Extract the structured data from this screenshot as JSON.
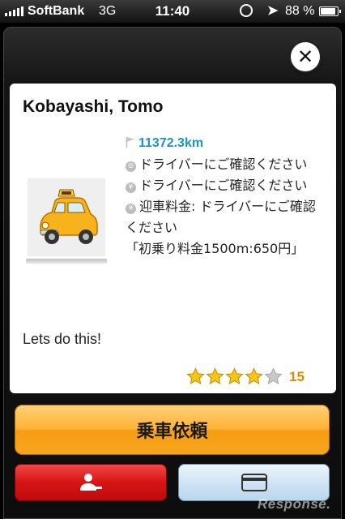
{
  "status_bar": {
    "carrier": "SoftBank",
    "network": "3G",
    "time": "11:40",
    "battery_percent": "88 %",
    "battery_level": 0.88
  },
  "driver": {
    "name": "Kobayashi, Tomo",
    "distance": "11372.3km",
    "info_lines": [
      "ドライバーにご確認ください",
      "ドライバーにご確認ください",
      "迎車料金: ドライバーにご確認ください"
    ],
    "fare_note": "「初乗り料金1500m:650円」",
    "message": "Lets do this!",
    "rating_stars": 4,
    "rating_max": 5,
    "rating_count": "15"
  },
  "actions": {
    "request_label": "乗車依頼"
  },
  "watermark": "Response.",
  "colors": {
    "accent_orange": "#ffb234",
    "distance_blue": "#1a94c9",
    "button_red": "#d61414",
    "button_blue": "#cfe4f3",
    "star_gold": "#f5c518"
  },
  "icons": [
    "close-icon",
    "flag-icon",
    "clock-icon",
    "yen-icon",
    "taxi-icon",
    "star-icon",
    "person-remove-icon",
    "credit-card-icon",
    "location-arrow-icon",
    "rotation-lock-icon",
    "battery-icon"
  ]
}
